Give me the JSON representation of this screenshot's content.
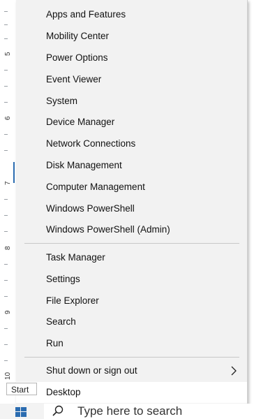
{
  "ruler": {
    "labels": [
      "5",
      "6",
      "7",
      "8",
      "9",
      "10"
    ]
  },
  "menu": {
    "group1": [
      {
        "label": "Apps and Features"
      },
      {
        "label": "Mobility Center"
      },
      {
        "label": "Power Options"
      },
      {
        "label": "Event Viewer"
      },
      {
        "label": "System"
      },
      {
        "label": "Device Manager"
      },
      {
        "label": "Network Connections"
      },
      {
        "label": "Disk Management"
      },
      {
        "label": "Computer Management"
      },
      {
        "label": "Windows PowerShell"
      },
      {
        "label": "Windows PowerShell (Admin)"
      }
    ],
    "group2": [
      {
        "label": "Task Manager"
      },
      {
        "label": "Settings"
      },
      {
        "label": "File Explorer"
      },
      {
        "label": "Search"
      },
      {
        "label": "Run"
      }
    ],
    "group3": [
      {
        "label": "Shut down or sign out",
        "submenu": true
      },
      {
        "label": "Desktop"
      }
    ]
  },
  "taskbar": {
    "start_tooltip": "Start",
    "search_placeholder": "Type here to search"
  }
}
